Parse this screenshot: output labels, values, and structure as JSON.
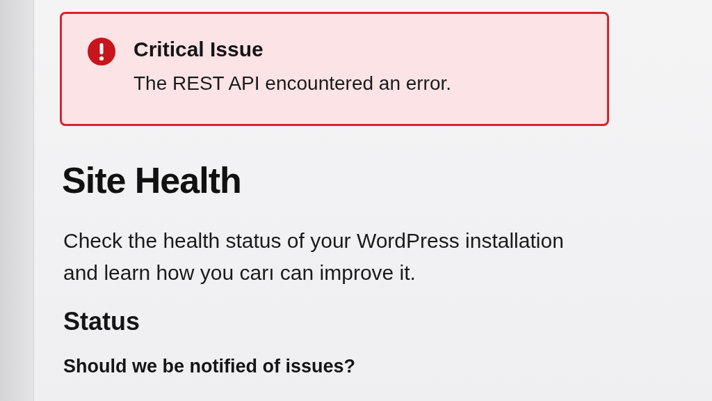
{
  "notice": {
    "kind": "error",
    "title": "Critical Issue",
    "message": "The REST API encountered an error."
  },
  "heading": "Site Health",
  "description": "Check the health status of your WordPress installation and learn how you carı can improve it.",
  "section": {
    "title": "Status",
    "question": "Should we be notified of issues?"
  }
}
